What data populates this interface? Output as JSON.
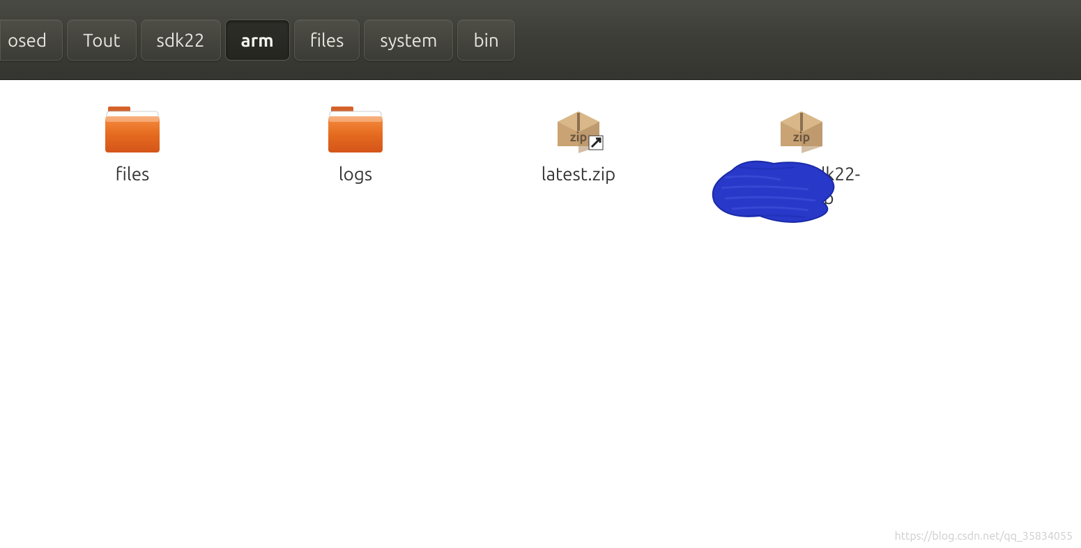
{
  "breadcrumbs": [
    {
      "label": "osed",
      "active": false
    },
    {
      "label": "Tout",
      "active": false
    },
    {
      "label": "sdk22",
      "active": false
    },
    {
      "label": "arm",
      "active": true
    },
    {
      "label": "files",
      "active": false
    },
    {
      "label": "system",
      "active": false
    },
    {
      "label": "bin",
      "active": false
    }
  ],
  "items": [
    {
      "name": "files",
      "type": "folder"
    },
    {
      "name": "logs",
      "type": "folder"
    },
    {
      "name": "latest.zip",
      "type": "zip-link"
    },
    {
      "name": "xposed-sdk22-arm-.zip",
      "type": "zip",
      "redacted": true
    }
  ],
  "watermark": "https://blog.csdn.net/qq_35834055"
}
